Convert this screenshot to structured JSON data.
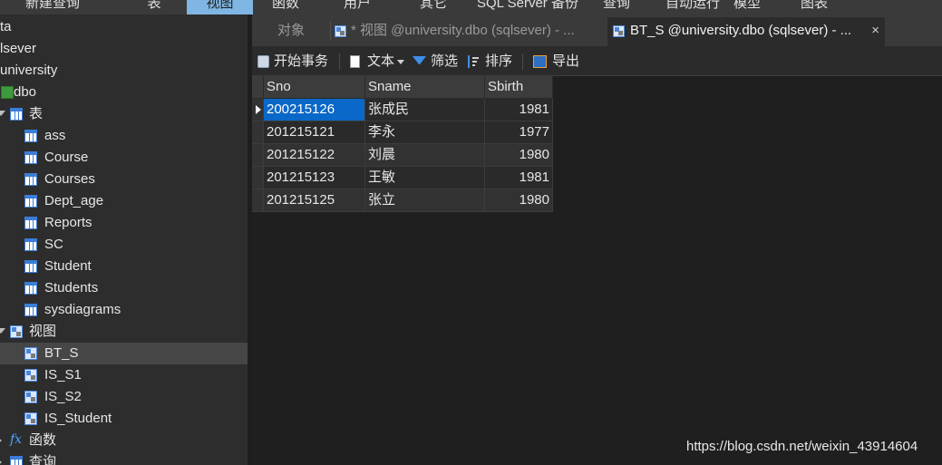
{
  "top_toolbar": {
    "items": [
      "新建查询",
      "表",
      "视图",
      "函数",
      "用户",
      "其它",
      "SQL Server 备份",
      "查询",
      "自动运行",
      "模型",
      "图表"
    ],
    "active_index": 2,
    "active_color": "#7fb6e4"
  },
  "sidebar": {
    "items": [
      {
        "label": "ta",
        "icon": "none"
      },
      {
        "label": "lsever",
        "icon": "none"
      },
      {
        "label": "university",
        "icon": "none"
      },
      {
        "label": "dbo",
        "icon": "schema-icon"
      },
      {
        "label": "表",
        "icon": "table-icon"
      },
      {
        "label": "ass",
        "icon": "table-icon"
      },
      {
        "label": "Course",
        "icon": "table-icon"
      },
      {
        "label": "Courses",
        "icon": "table-icon"
      },
      {
        "label": "Dept_age",
        "icon": "table-icon"
      },
      {
        "label": "Reports",
        "icon": "table-icon"
      },
      {
        "label": "SC",
        "icon": "table-icon"
      },
      {
        "label": "Student",
        "icon": "table-icon"
      },
      {
        "label": "Students",
        "icon": "table-icon"
      },
      {
        "label": "sysdiagrams",
        "icon": "table-icon"
      },
      {
        "label": "视图",
        "icon": "view-icon"
      },
      {
        "label": "BT_S",
        "icon": "view-icon"
      },
      {
        "label": "IS_S1",
        "icon": "view-icon"
      },
      {
        "label": "IS_S2",
        "icon": "view-icon"
      },
      {
        "label": "IS_Student",
        "icon": "view-icon"
      },
      {
        "label": "函数",
        "icon": "function-icon"
      },
      {
        "label": "查询",
        "icon": "query-icon"
      }
    ],
    "selected": "BT_S"
  },
  "tabs": {
    "items": [
      {
        "label": "对象"
      },
      {
        "label": "* 视图 @university.dbo (sqlsever) - ..."
      },
      {
        "label": "BT_S @university.dbo (sqlsever) - ...",
        "close": "×"
      }
    ],
    "active_index": 2
  },
  "object_toolbar": {
    "begin_transaction": "开始事务",
    "text": "文本",
    "filter": "筛选",
    "sort": "排序",
    "export": "导出"
  },
  "grid": {
    "columns": [
      "Sno",
      "Sname",
      "Sbirth"
    ],
    "rows": [
      [
        "200215126",
        "张成民",
        "1981"
      ],
      [
        "201215121",
        "李永",
        "1977"
      ],
      [
        "201215122",
        "刘晨",
        "1980"
      ],
      [
        "201215123",
        "王敏",
        "1981"
      ],
      [
        "201215125",
        "张立",
        "1980"
      ]
    ],
    "selected_color": "#0a68c8"
  },
  "watermark": "https://blog.csdn.net/weixin_43914604"
}
